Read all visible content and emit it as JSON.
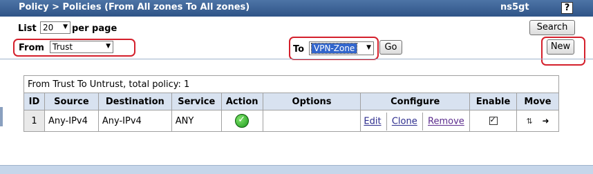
{
  "header": {
    "title": "Policy > Policies (From All zones To All zones)",
    "host": "ns5gt",
    "help_label": "?"
  },
  "list": {
    "label": "List",
    "value": "20",
    "suffix": "per page"
  },
  "from": {
    "label": "From",
    "value": "Trust"
  },
  "to": {
    "label": "To",
    "value": "VPN-Zone",
    "go_label": "Go"
  },
  "buttons": {
    "search": "Search",
    "new": "New"
  },
  "table": {
    "caption": "From Trust To Untrust, total policy: 1",
    "headers": [
      "ID",
      "Source",
      "Destination",
      "Service",
      "Action",
      "Options",
      "Configure",
      "Enable",
      "Move"
    ],
    "rows": [
      {
        "id": "1",
        "source": "Any-IPv4",
        "destination": "Any-IPv4",
        "service": "ANY",
        "action_icon": "permit-check-icon",
        "options": "",
        "configure": [
          "Edit",
          "Clone",
          "Remove"
        ],
        "enabled": true,
        "move_icons": [
          "reorder-icon",
          "move-arrow-icon"
        ]
      }
    ]
  },
  "colors": {
    "titlebar": "#2f5487",
    "header_row": "#d8e2f0",
    "highlight_box": "#d41f2b",
    "selected_option": "#3366cc"
  }
}
